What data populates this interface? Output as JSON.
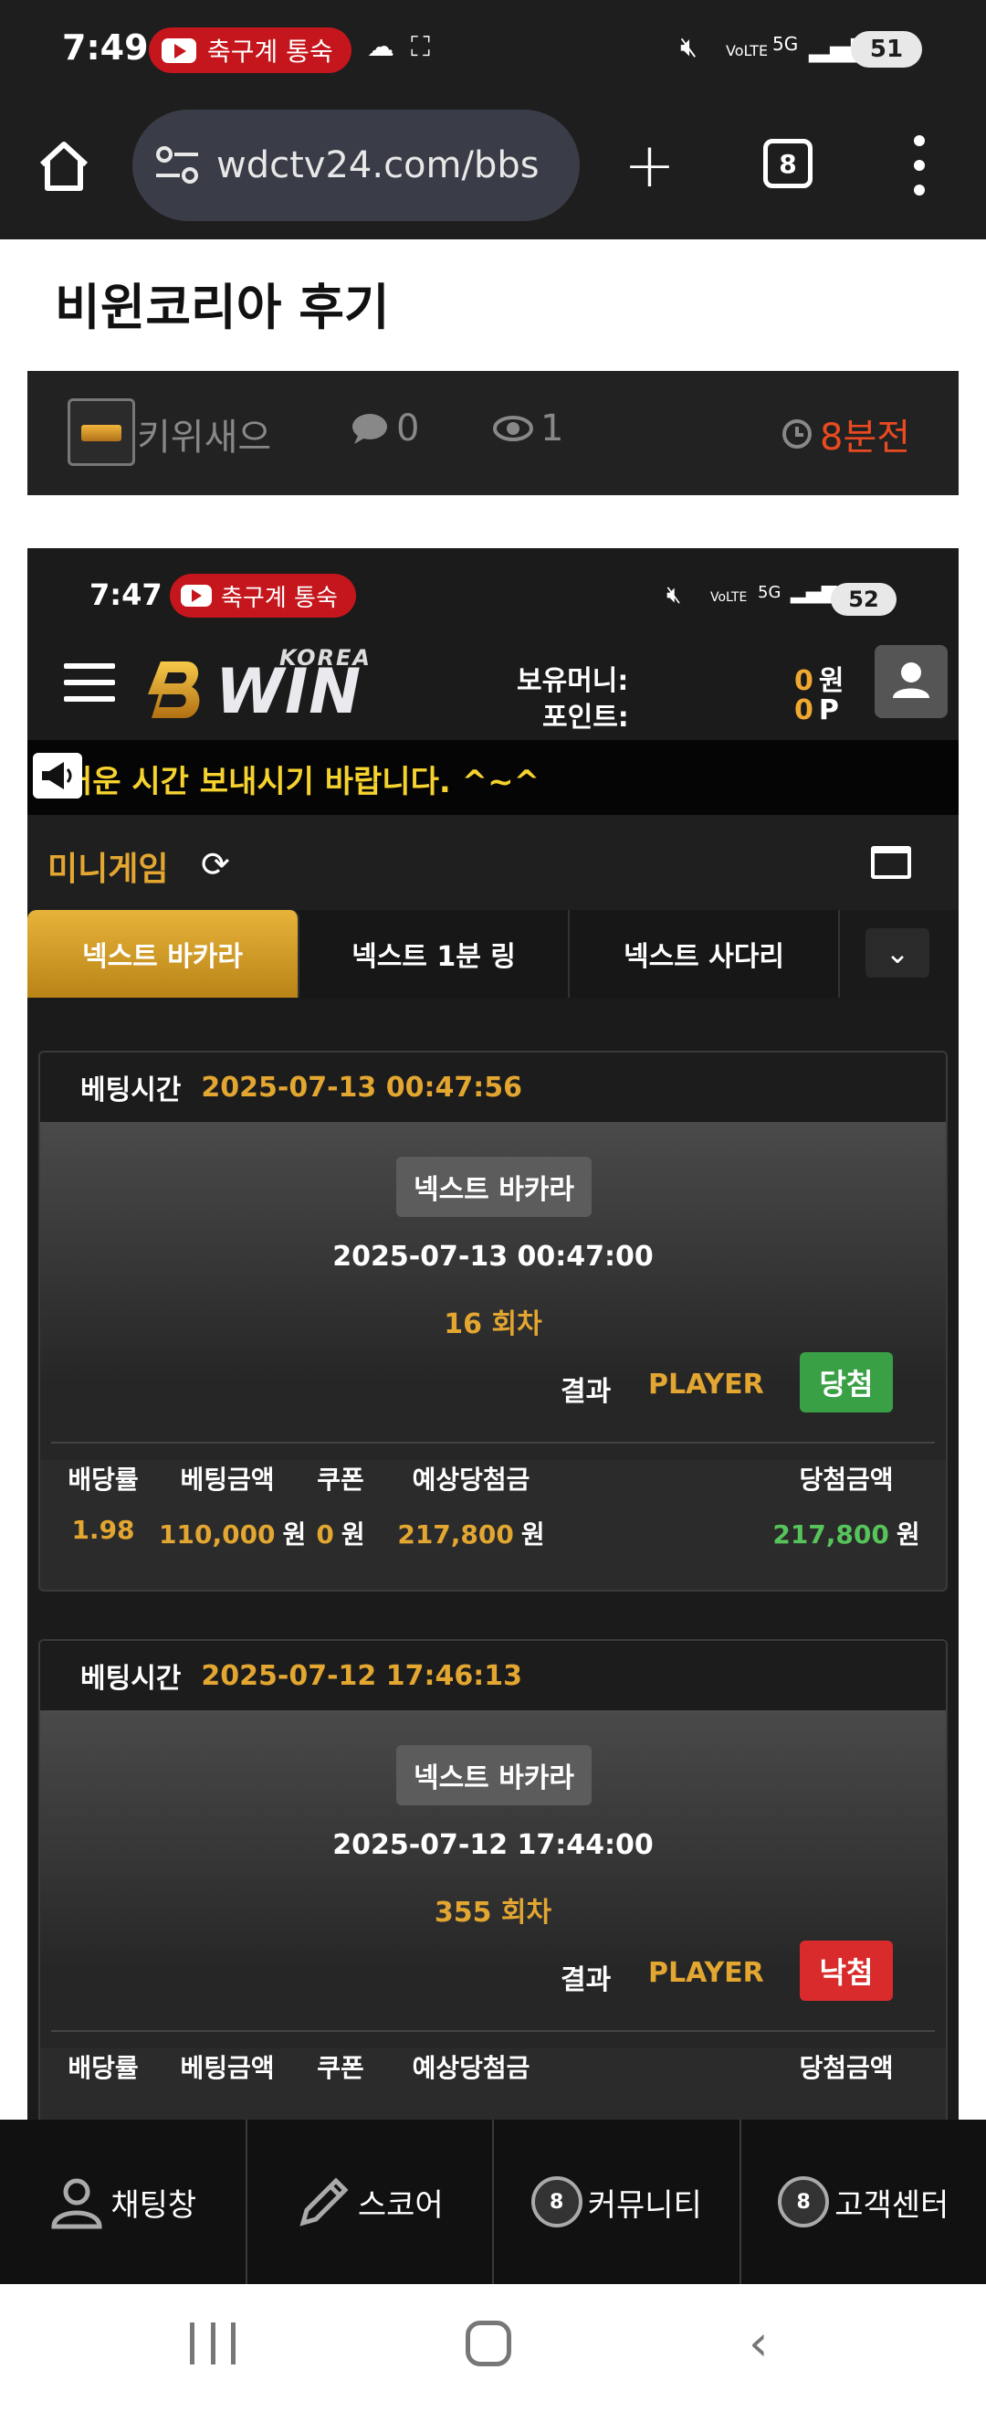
{
  "status_bar": {
    "time": "7:49",
    "notification_text": "축구계 통숙",
    "network": "5G",
    "lte": "VoLTE",
    "battery": "51"
  },
  "browser": {
    "url": "wdctv24.com/bbs",
    "tab_count": "8"
  },
  "post": {
    "title": "비윈코리아 후기",
    "author": "키위새으",
    "comment_count": "0",
    "view_count": "1",
    "time_ago": "8분전"
  },
  "embedded": {
    "status_bar": {
      "time": "7:47",
      "notification_text": "축구계 통숙",
      "network": "5G",
      "lte": "VoLTE",
      "battery": "52"
    },
    "header": {
      "logo_korea": "KOREA",
      "logo_win": "WIN",
      "money_label": "보유머니:",
      "money_value": "0",
      "money_unit": "원",
      "point_label": "포인트:",
      "point_value": "0",
      "point_unit": "P"
    },
    "ticker": "거운 시간 보내시기 바랍니다. ^~^",
    "mini_game_title": "미니게임",
    "tabs": [
      "넥스트 바카라",
      "넥스트 1분 링",
      "넥스트 사다리"
    ],
    "cards": [
      {
        "bet_time_label": "베팅시간",
        "bet_time": "2025-07-13 00:47:56",
        "game": "넥스트 바카라",
        "round_time": "2025-07-13 00:47:00",
        "round": "16 회차",
        "result_label": "결과",
        "result": "PLAYER",
        "outcome": "당첨",
        "stats_headers": [
          "배당률",
          "베팅금액",
          "쿠폰",
          "예상당첨금",
          "당첨금액"
        ],
        "odds": "1.98",
        "bet_amount": "110,000",
        "coupon": "0",
        "expected": "217,800",
        "won": "217,800",
        "unit": "원"
      },
      {
        "bet_time_label": "베팅시간",
        "bet_time": "2025-07-12 17:46:13",
        "game": "넥스트 바카라",
        "round_time": "2025-07-12 17:44:00",
        "round": "355 회차",
        "result_label": "결과",
        "result": "PLAYER",
        "outcome": "낙첨",
        "stats_headers": [
          "배당률",
          "베팅금액",
          "쿠폰",
          "예상당첨금",
          "당첨금액"
        ]
      }
    ]
  },
  "bottom_nav": [
    "채팅창",
    "스코어",
    "커뮤니티",
    "고객센터"
  ],
  "colors": {
    "accent_gold": "#e2a631",
    "win_green": "#3aa046",
    "lose_red": "#d92b2b",
    "time_orange": "#e94a20"
  }
}
